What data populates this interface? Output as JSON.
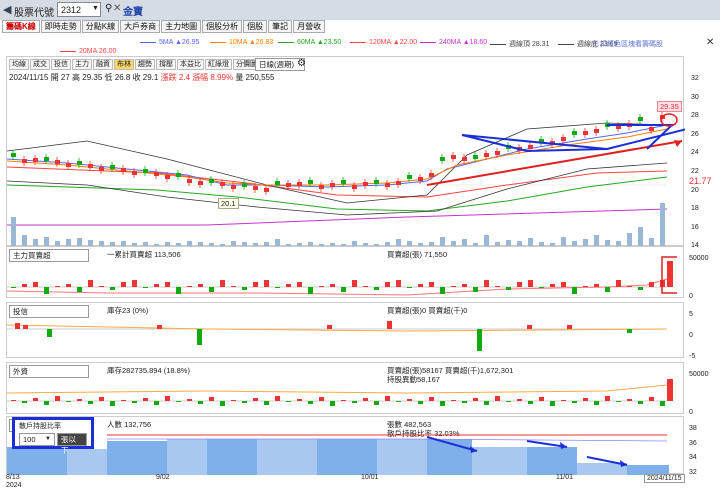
{
  "header": {
    "title": "股票代號",
    "code": "2312",
    "name": "金寶"
  },
  "tabs": [
    "籌碼K線",
    "即時走勢",
    "分點K線",
    "大戶券商",
    "主力地圖",
    "個股分析",
    "個股",
    "筆記",
    "月營收"
  ],
  "ma": [
    {
      "label": "5MA ▲26.95",
      "color": "#5566ff"
    },
    {
      "label": "10MA ▲26.83",
      "color": "#ff7f00"
    },
    {
      "label": "60MA ▲23.50",
      "color": "#22aa22"
    },
    {
      "label": "120MA ▲22.00",
      "color": "#ff4444"
    },
    {
      "label": "240MA ▲18.60",
      "color": "#cc33cc"
    },
    {
      "label": "週線頂 28.31",
      "color": "#444"
    },
    {
      "label": "週線底 23.69",
      "color": "#444"
    },
    {
      "label": "20MA 26.00",
      "color": "#ff4444"
    }
  ],
  "promo": "扣紅色區塊看籌碼股",
  "toolbar": [
    "均線",
    "成交",
    "投信",
    "主力",
    "融資",
    "布林",
    "趨勢",
    "撐壓",
    "本益比",
    "紅綠燈",
    "分價圖"
  ],
  "range": "日線(週期)",
  "ohlc": {
    "date": "2024/11/15",
    "open": "開 27",
    "high": "高 29.35",
    "low": "低 26.8",
    "close": "收 29.1",
    "change": "漲跌 2.4",
    "pct": "漲幅 8.99%",
    "vol": "量 250,555"
  },
  "price_labels": {
    "high": "29.35",
    "low": "20.1",
    "mark": "21.77"
  },
  "price_axis": [
    "32",
    "30",
    "28",
    "26",
    "24",
    "22",
    "20",
    "18",
    "16",
    "14"
  ],
  "panels": {
    "main": {
      "name": "主力買賣超",
      "l1": "一累計買賣超 113,506",
      "l2": "買賣超(張) 71,550",
      "ticks": [
        "50000",
        "0"
      ]
    },
    "trust": {
      "name": "投信",
      "l1": "庫存23 (0%)",
      "l2": "買賣超(張)0 買賣超(千)0",
      "ticks": [
        "5",
        "0",
        "-5"
      ]
    },
    "foreign": {
      "name": "外資",
      "l1": "庫存282735.894 (18.8%)",
      "l2": "買賣超(張)58167 買賣超(千)1,672,301",
      "l3": "持股異動58,167",
      "ticks": [
        "50000",
        "0"
      ]
    },
    "holders": {
      "name": "散戶持股比率",
      "l1": "人數 132,756",
      "l2": "張數 482,563",
      "l3": "散戶持股比率 32.03%",
      "threshold": "100",
      "cond": "張以下",
      "ticks": [
        "38",
        "36",
        "34",
        "32"
      ]
    }
  },
  "dates": [
    "8/13",
    "2024",
    "9/02",
    "10/01",
    "11/01",
    "2024/11/15"
  ]
}
